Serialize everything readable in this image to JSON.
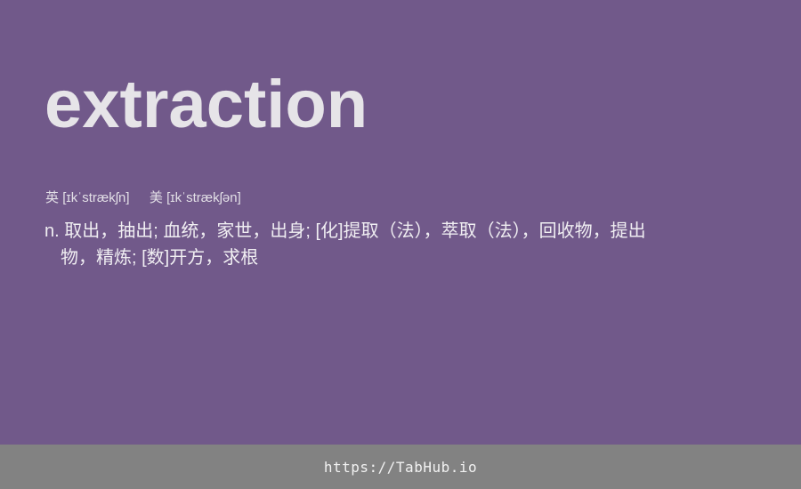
{
  "entry": {
    "word": "extraction",
    "phonetics": {
      "uk_label": "英",
      "uk_ipa": "[ɪkˈstrækʃn]",
      "us_label": "美",
      "us_ipa": "[ɪkˈstrækʃən]"
    },
    "definition": "n. 取出，抽出; 血统，家世，出身; [化]提取（法），萃取（法），回收物，提出物，精炼; [数]开方，求根"
  },
  "footer": {
    "link_text": "https://TabHub.io"
  }
}
